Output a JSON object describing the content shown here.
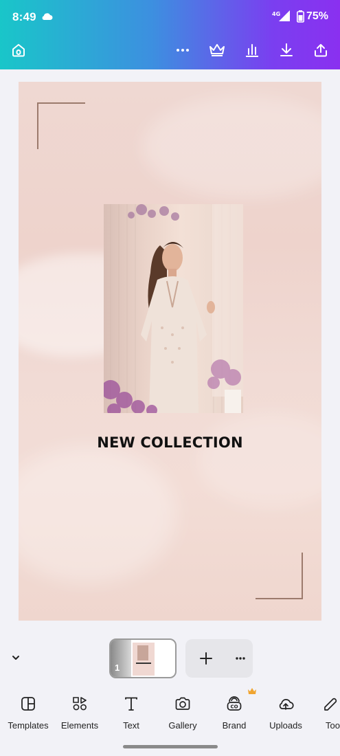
{
  "status_bar": {
    "time": "8:49",
    "network": "4G",
    "battery": "75%",
    "icons": [
      "cloud-icon",
      "signal-icon",
      "battery-icon"
    ]
  },
  "top_toolbar": {
    "icons": [
      "home-icon",
      "more-icon",
      "crown-icon",
      "chart-icon",
      "download-icon",
      "share-icon"
    ]
  },
  "design": {
    "headline": "NEW COLLECTION",
    "background_color": "#efd8d2",
    "frame_color": "#9b7a6c"
  },
  "pages": {
    "current_page_number": "1"
  },
  "bottom_toolbar": {
    "items": [
      {
        "label": "Templates",
        "icon": "templates-icon"
      },
      {
        "label": "Elements",
        "icon": "elements-icon"
      },
      {
        "label": "Text",
        "icon": "text-icon"
      },
      {
        "label": "Gallery",
        "icon": "camera-icon"
      },
      {
        "label": "Brand",
        "icon": "brand-icon"
      },
      {
        "label": "Uploads",
        "icon": "cloud-upload-icon"
      },
      {
        "label": "Too",
        "icon": "tools-icon"
      }
    ]
  },
  "colors": {
    "header_gradient_start": "#19c6c9",
    "header_gradient_end": "#8a30f0",
    "premium_crown": "#f0a531"
  }
}
